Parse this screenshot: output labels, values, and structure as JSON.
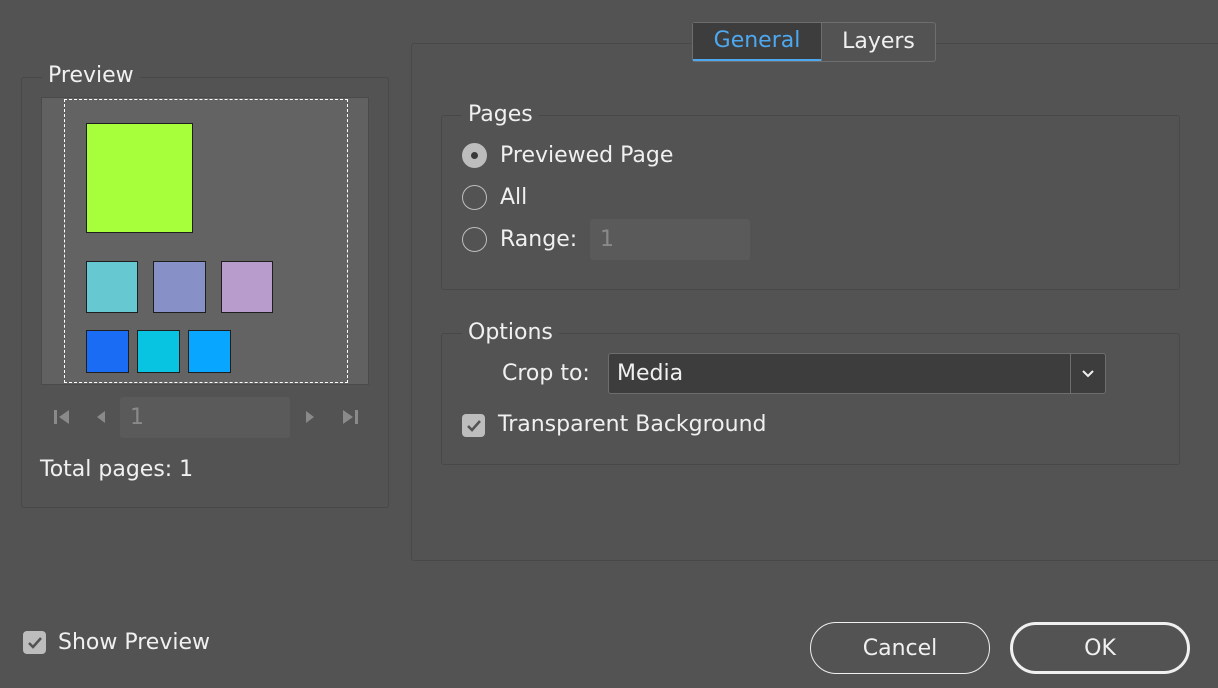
{
  "preview": {
    "legend": "Preview",
    "page_number": "1",
    "total_pages": "Total pages: 1",
    "swatch_colors": [
      "#a6ff3a",
      "#66c8d0",
      "#8890c8",
      "#b89ccc",
      "#1b6cf5",
      "#08c4e0",
      "#08a6ff"
    ]
  },
  "tabs": {
    "general": "General",
    "layers": "Layers"
  },
  "pages": {
    "legend": "Pages",
    "previewed_page": "Previewed Page",
    "all": "All",
    "range": "Range:",
    "range_value": "1",
    "selected": "previewed_page"
  },
  "options": {
    "legend": "Options",
    "crop_to_label": "Crop to:",
    "crop_to_value": "Media",
    "transparent_background": "Transparent Background",
    "transparent_background_checked": true
  },
  "footer": {
    "show_preview": "Show Preview",
    "show_preview_checked": true,
    "cancel": "Cancel",
    "ok": "OK"
  },
  "colors": {
    "background": "#535353",
    "accent": "#4ea8f0"
  }
}
